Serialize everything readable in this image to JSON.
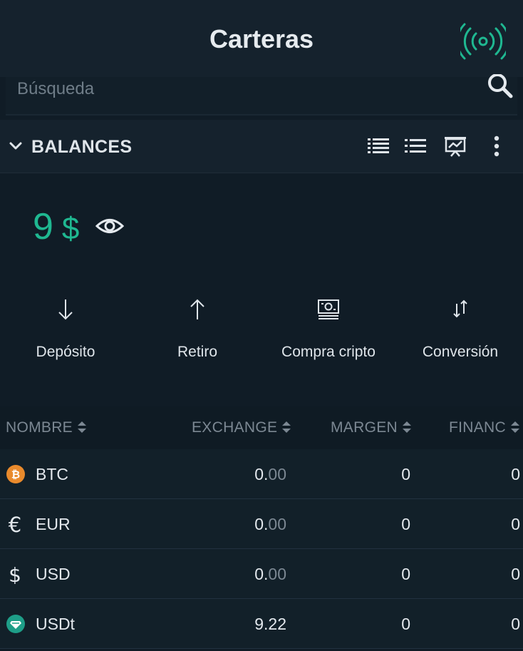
{
  "header": {
    "title": "Carteras"
  },
  "search": {
    "placeholder": "Búsqueda"
  },
  "balances": {
    "section_label": "BALANCES",
    "total_value": "9",
    "currency_symbol": "$"
  },
  "actions": [
    {
      "label": "Depósito",
      "icon": "arrow-down-icon"
    },
    {
      "label": "Retiro",
      "icon": "arrow-up-icon"
    },
    {
      "label": "Compra cripto",
      "icon": "cash-icon"
    },
    {
      "label": "Conversión",
      "icon": "swap-icon"
    }
  ],
  "table": {
    "columns": [
      "NOMBRE",
      "EXCHANGE",
      "MARGEN",
      "FINANC"
    ],
    "rows": [
      {
        "symbol": "BTC",
        "icon": "bitcoin-icon",
        "exchange_int": "0.",
        "exchange_dec": "00",
        "margin": "0",
        "funding": "0"
      },
      {
        "symbol": "EUR",
        "icon": "euro-icon",
        "exchange_int": "0.",
        "exchange_dec": "00",
        "margin": "0",
        "funding": "0"
      },
      {
        "symbol": "USD",
        "icon": "dollar-icon",
        "exchange_int": "0.",
        "exchange_dec": "00",
        "margin": "0",
        "funding": "0"
      },
      {
        "symbol": "USDt",
        "icon": "tether-icon",
        "exchange_int": "9.22",
        "exchange_dec": "",
        "margin": "0",
        "funding": "0"
      }
    ]
  },
  "colors": {
    "background": "#101c26",
    "accent": "#1fb891",
    "muted": "#7c8893"
  }
}
